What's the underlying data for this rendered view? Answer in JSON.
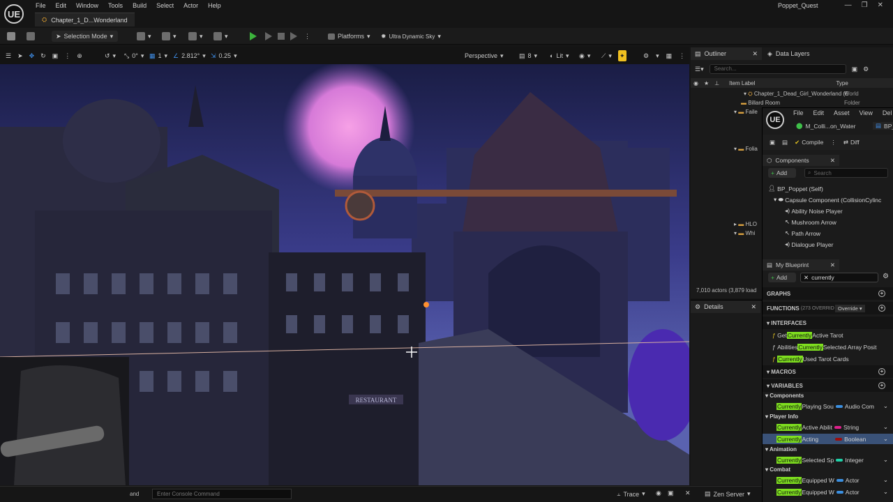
{
  "app": {
    "title": "Poppet_Quest",
    "logo": "UE",
    "document_tab": "Chapter_1_D...Wonderland"
  },
  "menu": [
    "File",
    "Edit",
    "Window",
    "Tools",
    "Build",
    "Select",
    "Actor",
    "Help"
  ],
  "toolbar": {
    "selection_mode": "Selection Mode",
    "platforms": "Platforms",
    "sky": "Ultra Dynamic Sky"
  },
  "viewport_toolbar": {
    "rotation_snap": "0°",
    "grid_snap": "1",
    "angle": "2.812°",
    "scale_snap": "0.25",
    "view_mode": "Perspective",
    "camera_speed": "8",
    "lighting": "Lit"
  },
  "outliner": {
    "tab": "Outliner",
    "tab2": "Data Layers",
    "search_placeholder": "Search...",
    "col_label": "Item Label",
    "col_type": "Type",
    "items": [
      {
        "label": "Chapter_1_Dead_Girl_Wonderland (E",
        "type": "World"
      },
      {
        "label": "Billard Room",
        "type": "Folder"
      },
      {
        "label": "Faile",
        "type": ""
      },
      {
        "label": "Folia",
        "type": ""
      },
      {
        "label": "HLO",
        "type": ""
      },
      {
        "label": "Whi",
        "type": ""
      }
    ],
    "status": "7,010 actors (3,879 load"
  },
  "details": {
    "tab": "Details"
  },
  "blueprint": {
    "menu": [
      "File",
      "Edit",
      "Asset",
      "View",
      "Del"
    ],
    "tab1": "M_Colli...on_Water",
    "tab2": "BP_",
    "compile": "Compile",
    "diff": "Diff",
    "components_tab": "Components",
    "add": "Add",
    "search_placeholder": "Search",
    "components": [
      "BP_Poppet (Self)",
      "Capsule Component (CollisionCylinc",
      "Ability Noise Player",
      "Mushroom Arrow",
      "Path Arrow",
      "Dialogue Player"
    ],
    "my_blueprint_tab": "My Blueprint",
    "search_value": "currently",
    "graphs": "GRAPHS",
    "functions": "FUNCTIONS",
    "functions_count": "(273 OVERRID",
    "override": "Override",
    "interfaces": "INTERFACES",
    "interface_items": [
      {
        "pre": "Get ",
        "hl": "Currently",
        "post": " Active Tarot"
      },
      {
        "pre": "Abilities ",
        "hl": "Currently",
        "post": " Selected Array Posit"
      },
      {
        "pre": "",
        "hl": "Currently",
        "post": " Used Tarot Cards"
      }
    ],
    "macros": "MACROS",
    "variables": "VARIABLES",
    "var_groups": [
      {
        "name": "Components",
        "vars": [
          {
            "hl": "Currently",
            "post": " Playing Sou",
            "type": "Audio Com",
            "color": "#3b8fe0"
          }
        ]
      },
      {
        "name": "Player Info",
        "vars": [
          {
            "hl": "Currently",
            "post": " Active Abilit",
            "type": "String",
            "color": "#e0208c"
          },
          {
            "hl": "Currently",
            "post": " Acting",
            "type": "Boolean",
            "color": "#9a0d0d"
          }
        ]
      },
      {
        "name": "Animation",
        "vars": [
          {
            "hl": "Currently",
            "post": " Selected Sp",
            "type": "Integer",
            "color": "#1fd1a8"
          }
        ]
      },
      {
        "name": "Combat",
        "vars": [
          {
            "hl": "Currently",
            "post": " Equipped W",
            "type": "Actor",
            "color": "#3b8fe0"
          },
          {
            "hl": "Currently",
            "post": " Equipped W",
            "type": "Actor",
            "color": "#3b8fe0"
          }
        ]
      }
    ]
  },
  "console": {
    "placeholder": "Enter Console Command",
    "cmd_label": "and",
    "trace": "Trace",
    "zen": "Zen Server"
  },
  "viewport_signs": {
    "restaurant": "RESTAURANT"
  }
}
